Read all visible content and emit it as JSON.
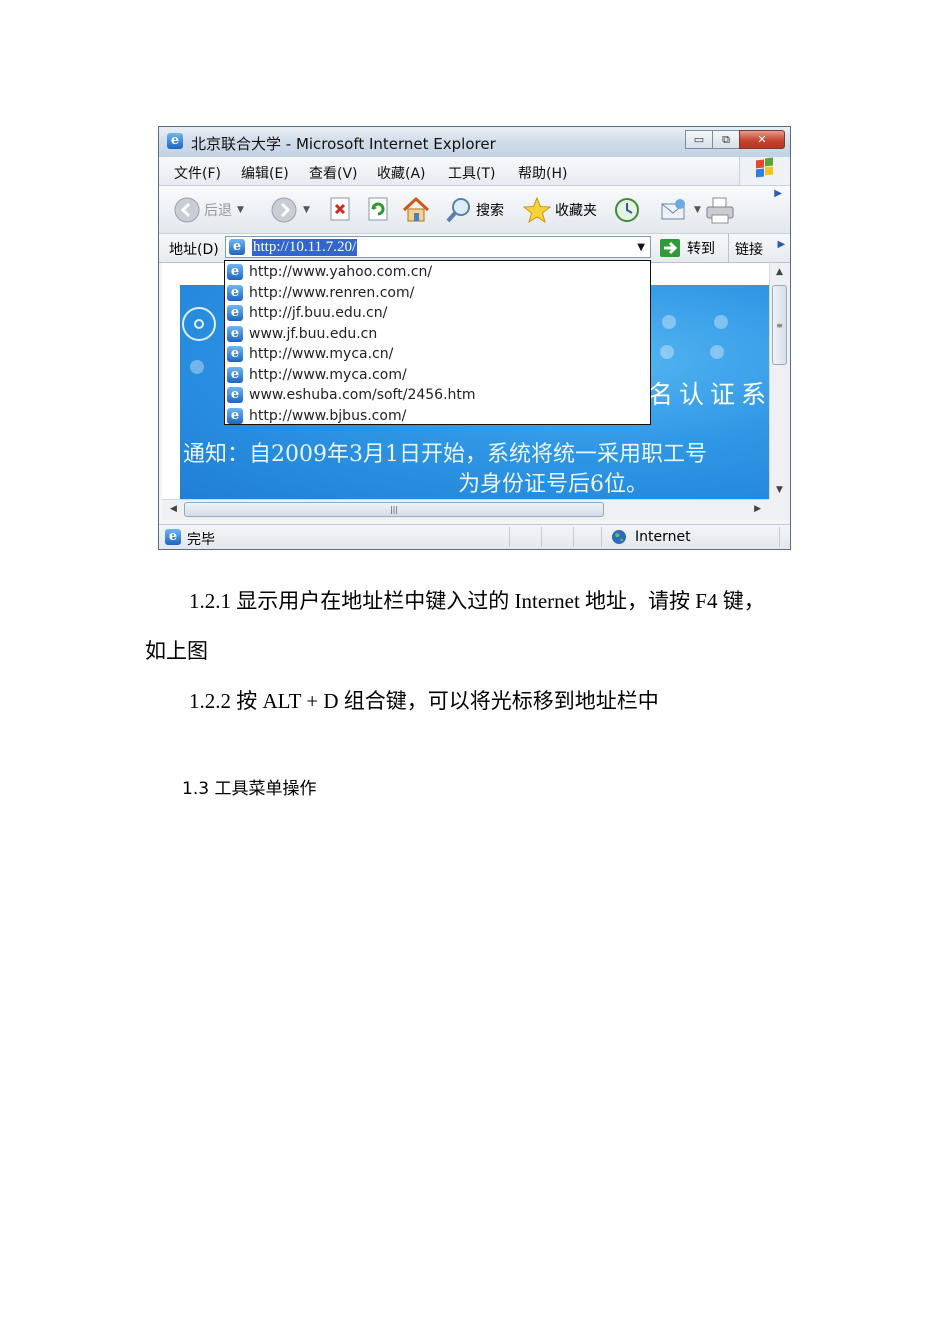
{
  "browser": {
    "title": "北京联合大学 - Microsoft Internet Explorer",
    "window_buttons": [
      "minimize-icon",
      "restore-icon",
      "close-icon"
    ],
    "menu": [
      "文件(F)",
      "编辑(E)",
      "查看(V)",
      "收藏(A)",
      "工具(T)",
      "帮助(H)"
    ],
    "toolbar": {
      "back": "后退",
      "search": "搜索",
      "favorites": "收藏夹"
    },
    "address": {
      "label": "地址(D)",
      "value": "http://10.11.7.20/",
      "go": "转到",
      "links": "链接"
    },
    "history": [
      "http://www.yahoo.com.cn/",
      "http://www.renren.com/",
      "http://jf.buu.edu.cn/",
      "www.jf.buu.edu.cn",
      "http://www.myca.cn/",
      "http://www.myca.com/",
      "www.eshuba.com/soft/2456.htm",
      "http://www.bjbus.com/"
    ],
    "page": {
      "banner_title": "名认证系",
      "notice_line1": "通知：自2009年3月1日开始，系统将统一采用职工号",
      "notice_line2": "为身份证号后6位。"
    },
    "status": {
      "text": "完毕",
      "zone": "Internet"
    },
    "colors": {
      "selection": "#3366cc",
      "banner": "#2f97e6",
      "close_button": "#c6452f"
    }
  },
  "document": {
    "para1_line1": "1.2.1 显示用户在地址栏中键入过的  Internet 地址，请按  F4 键，",
    "para1_line2": "如上图",
    "para2": "1.2.2 按  ALT + D 组合键，可以将光标移到地址栏中",
    "heading": "1.3 工具菜单操作"
  }
}
